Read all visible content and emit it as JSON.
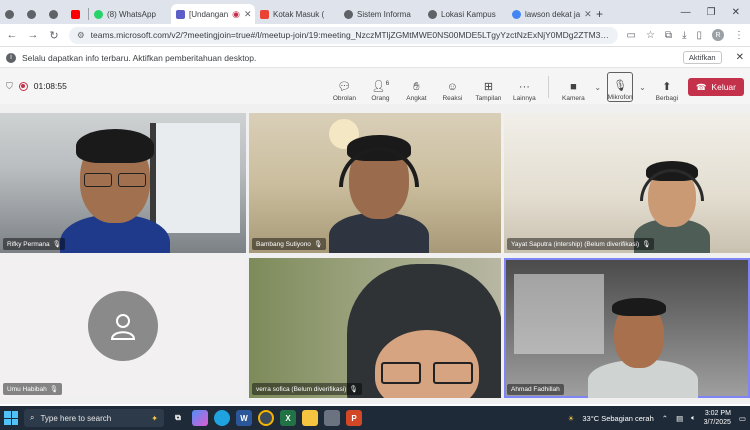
{
  "browser": {
    "tabs": [
      {
        "label": "",
        "color": "#5f6368"
      },
      {
        "label": "",
        "color": "#5f6368"
      },
      {
        "label": "",
        "color": "#5f6368"
      },
      {
        "label": "",
        "color": "#ff0000"
      },
      {
        "label": "(8) WhatsApp",
        "color": "#25d366"
      },
      {
        "label": "[Undangan",
        "color": "#5b5fc7",
        "active": true
      },
      {
        "label": "Kotak Masuk (",
        "color": "#ea4335"
      },
      {
        "label": "Sistem Informa",
        "color": "#5f6368"
      },
      {
        "label": "Lokasi Kampus",
        "color": "#5f6368"
      },
      {
        "label": "lawson dekat ja",
        "color": "#4285f4"
      }
    ],
    "new_tab": "+",
    "url": "teams.microsoft.com/v2/?meetingjoin=true#/l/meetup-join/19:meeting_NzczMTljZGMtMWE0NS00MDE5LTgyYzctNzExNjY0MDg2ZTM3@thread.v2/..."
  },
  "infobar": {
    "message": "Selalu dapatkan info terbaru. Aktifkan pemberitahuan desktop.",
    "button": "Aktifkan"
  },
  "meeting": {
    "timer": "01:08:55",
    "tools": [
      {
        "label": "Obrolan",
        "icon": "chat-icon"
      },
      {
        "label": "Orang",
        "icon": "people-icon",
        "count": "6"
      },
      {
        "label": "Angkat",
        "icon": "raise-hand-icon"
      },
      {
        "label": "Reaksi",
        "icon": "reaction-icon"
      },
      {
        "label": "Tampilan",
        "icon": "view-icon"
      },
      {
        "label": "Lainnya",
        "icon": "more-icon"
      }
    ],
    "camera_label": "Kamera",
    "mic_label": "Mikrofon",
    "share_label": "Berbagi",
    "leave_label": "Keluar"
  },
  "participants": [
    {
      "name": "Rifky Permana"
    },
    {
      "name": "Bambang Sutiyono"
    },
    {
      "name": "Yayat Saputra (intership) (Belum diverifikasi)"
    },
    {
      "name": "Umu Habibah"
    },
    {
      "name": "verra sofica (Belum diverifikasi)"
    },
    {
      "name": "Ahmad Fadhillah"
    }
  ],
  "taskbar": {
    "search_placeholder": "Type here to search",
    "weather": "33°C  Sebagian cerah",
    "time": "3:02 PM",
    "date": "3/7/2025"
  }
}
